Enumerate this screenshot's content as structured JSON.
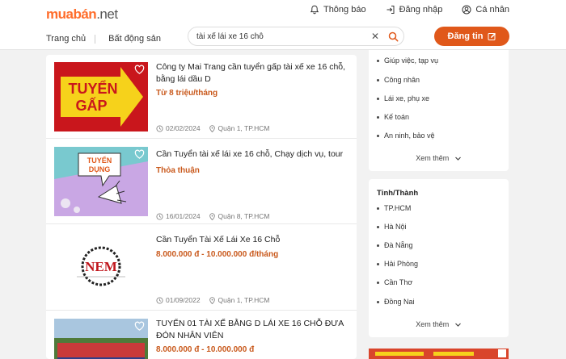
{
  "header": {
    "logo_brand": "muabán",
    "logo_tld": ".net",
    "top_links": [
      {
        "label": "Thông báo",
        "icon": "bell-icon"
      },
      {
        "label": "Đăng nhập",
        "icon": "login-icon"
      },
      {
        "label": "Cá nhân",
        "icon": "user-icon"
      }
    ],
    "nav": [
      "Trang chủ",
      "Bất động sản"
    ],
    "search_value": "tài xế lái xe 16 chỗ",
    "post_button": "Đăng tin"
  },
  "listings": [
    {
      "title": "Công ty Mai Trang cần tuyển gấp tài xế xe 16 chỗ, bằng lái dầu D",
      "price": "Từ 8 triệu/tháng",
      "date": "02/02/2024",
      "location": "Quận 1, TP.HCM",
      "thumb_text": [
        "TUYỂN",
        "GẤP"
      ]
    },
    {
      "title": "Cần Tuyển tài xế lái xe 16 chỗ, Chạy dịch vụ, tour",
      "price": "Thỏa thuận",
      "date": "16/01/2024",
      "location": "Quận 8, TP.HCM",
      "thumb_text": [
        "TUYỂN",
        "DỤNG"
      ]
    },
    {
      "title": "Cần Tuyển Tài Xế Lái Xe 16 Chỗ",
      "price": "8.000.000 đ - 10.000.000 đ/tháng",
      "date": "01/09/2022",
      "location": "Quận 1, TP.HCM",
      "thumb_text": [
        "NEM"
      ]
    },
    {
      "title": "TUYỂN 01 TÀI XẾ BẰNG D LÁI XE 16 CHỖ ĐƯA ĐÓN NHÂN VIÊN",
      "price": "8.000.000 đ - 10.000.000 đ",
      "date": "",
      "location": "",
      "thumb_text": []
    }
  ],
  "sidebar": {
    "categories": [
      "Giúp việc, tạp vụ",
      "Công nhân",
      "Lái xe, phụ xe",
      "Kế toán",
      "An ninh, bảo vệ"
    ],
    "more_label": "Xem thêm",
    "region_title": "Tỉnh/Thành",
    "regions": [
      "TP.HCM",
      "Hà Nội",
      "Đà Nẵng",
      "Hải Phòng",
      "Cần Thơ",
      "Đồng Nai"
    ],
    "region_more_label": "Xem thêm"
  },
  "colors": {
    "accent": "#e0581a",
    "brand": "#ff6d2b",
    "price": "#c9591c"
  }
}
